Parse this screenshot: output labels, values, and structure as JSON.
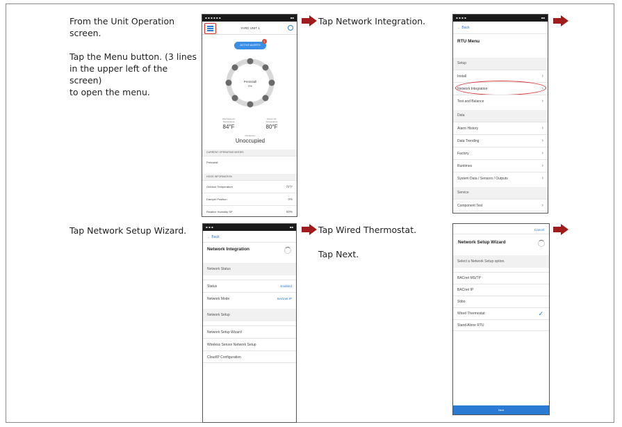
{
  "instructions": {
    "step1": [
      "From the Unit Operation",
      "screen.",
      "",
      "Tap the Menu button. (3 lines",
      "in the upper left of the screen)",
      "to open the menu."
    ],
    "step2": "Tap Network Integration.",
    "step3": "Tap Network Setup Wizard.",
    "step4a": "Tap Wired Thermostat.",
    "step4b": "Tap Next."
  },
  "colors": {
    "arrow": "#a01c1c",
    "accent": "#2a7ad4",
    "highlight": "#d43030"
  },
  "phone1": {
    "title": "YARD UNIT 1",
    "alerts_button": "ACTIVE ALERTS",
    "alert_count": "1",
    "ring_label": "Preinstall",
    "ring_pct": "0%",
    "temp_left_label": [
      "Discharge Air",
      "Temperature"
    ],
    "temp_left": "84°F",
    "temp_right_label": [
      "Return Air",
      "Temperature"
    ],
    "temp_right": "80°F",
    "occupancy_label": "Occupancy",
    "occupancy": "Unoccupied",
    "modes_header": "CURRENT OPERATING MODES",
    "mode": "Preinstall",
    "info_header": "HOOD INFORMATION",
    "info": [
      {
        "label": "Outdoor Temperature",
        "value": "72°F"
      },
      {
        "label": "Damper Position",
        "value": "0%"
      },
      {
        "label": "Relative Humidity SP",
        "value": "60%"
      }
    ]
  },
  "phone2": {
    "back": "Back",
    "title": "RTU Menu",
    "sections": [
      {
        "header": "Setup",
        "items": [
          "Install",
          "Network Integration",
          "Test and Balance"
        ]
      },
      {
        "header": "Data",
        "items": [
          "Alarm History",
          "Data Trending",
          "Factory",
          "Runtimes",
          "System Data / Sensors / Outputs"
        ]
      },
      {
        "header": "Service",
        "items": [
          "Component Test"
        ]
      }
    ]
  },
  "phone3": {
    "back": "Back",
    "title": "Network Integration",
    "status_header": "Network Status",
    "status_rows": [
      {
        "label": "Status",
        "value": "Enabled"
      },
      {
        "label": "Network Mode",
        "value": "BACnet IP"
      }
    ],
    "setup_header": "Network Setup",
    "setup_items": [
      "Network Setup Wizard",
      "Wireless Sensor Network Setup",
      "CloudIP Configuration"
    ]
  },
  "phone4": {
    "cancel": "Cancel",
    "title": "Network Setup Wizard",
    "prompt": "Select a Network Setup option.",
    "options": [
      "BACnet MS/TP",
      "BACnet IP",
      "Stibo",
      "Wired Thermostat",
      "Stand Alone RTU"
    ],
    "selected_index": 3,
    "next": "Next"
  }
}
